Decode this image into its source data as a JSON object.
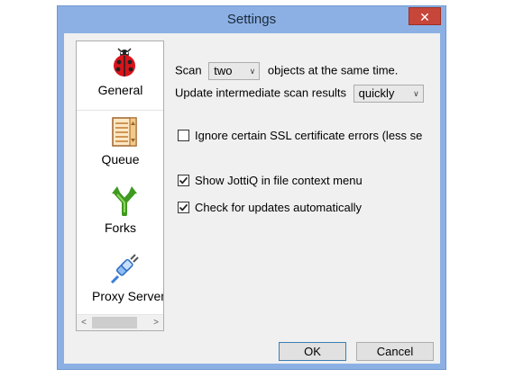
{
  "window": {
    "title": "Settings",
    "close_glyph": "✕"
  },
  "sidebar": {
    "items": [
      {
        "label": "General",
        "icon": "ladybug-icon"
      },
      {
        "label": "Queue",
        "icon": "list-document-icon"
      },
      {
        "label": "Forks",
        "icon": "fork-icon"
      },
      {
        "label": "Proxy Server",
        "icon": "plug-icon"
      }
    ],
    "scroll_left": "<",
    "scroll_right": ">"
  },
  "general": {
    "scan_prefix": "Scan",
    "scan_value": "two",
    "scan_suffix": "objects at the same time.",
    "update_label": "Update intermediate scan results",
    "update_value": "quickly",
    "ssl_label": "Ignore certain SSL certificate errors (less se",
    "ssl_checked": false,
    "context_menu_label": "Show JottiQ in file context menu",
    "context_menu_checked": true,
    "auto_update_label": "Check for updates automatically",
    "auto_update_checked": true
  },
  "buttons": {
    "ok": "OK",
    "cancel": "Cancel"
  },
  "colors": {
    "frame": "#8cb0e4",
    "client": "#f0f0f0",
    "close": "#c7463a"
  }
}
